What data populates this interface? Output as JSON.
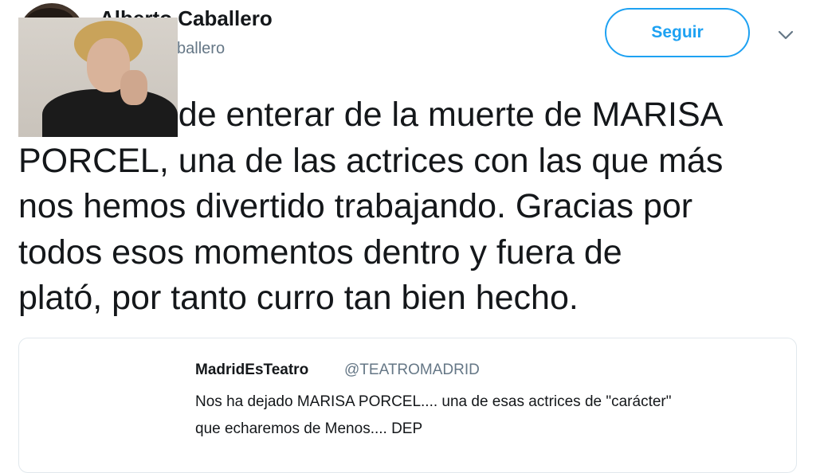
{
  "author": {
    "name": "Alberto Caballero",
    "handle": "@alber_caballero"
  },
  "follow_button": {
    "label": "Seguir"
  },
  "tweet": {
    "text": "Me acabo de enterar de la muerte de MARISA\nPORCEL, una de las actrices con las que más\nnos hemos divertido trabajando. Gracias por\ntodos esos momentos dentro y fuera de\nplató, por tanto curro tan bien hecho."
  },
  "quoted_tweet": {
    "name": "MadridEsTeatro",
    "handle": "@TEATROMADRID",
    "text": "Nos ha dejado MARISA PORCEL.... una de esas actrices de \"carácter\"\nque echaremos de Menos.... DEP"
  },
  "icons": {
    "menu": "chevron-down-icon"
  },
  "colors": {
    "accent": "#1da1f2",
    "text": "#14171a",
    "secondary": "#657786",
    "border": "#e1e8ed"
  }
}
